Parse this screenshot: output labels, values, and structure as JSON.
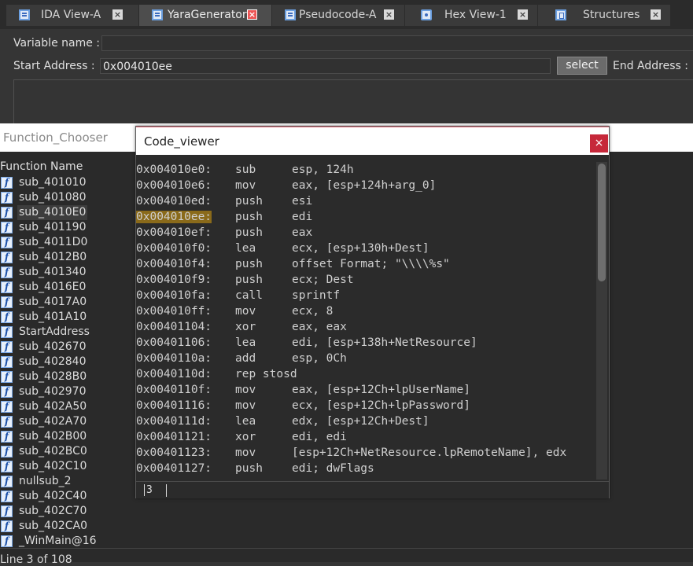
{
  "tabs": [
    {
      "label": "IDA View-A",
      "icon": "ida-view-icon",
      "active": false
    },
    {
      "label": "YaraGenerator",
      "icon": "yara-generator-icon",
      "active": true
    },
    {
      "label": "Pseudocode-A",
      "icon": "pseudocode-icon",
      "active": false
    },
    {
      "label": "Hex View-1",
      "icon": "hex-view-icon",
      "active": false
    },
    {
      "label": "Structures",
      "icon": "structures-icon",
      "active": false
    }
  ],
  "tab_close_glyph": "×",
  "form": {
    "variable_name_label": "Variable name :",
    "variable_name_value": "",
    "start_address_label": "Start Address :",
    "start_address_value": "0x004010ee",
    "select_label": "select",
    "end_address_label": "End Address :"
  },
  "function_chooser": {
    "title": "Function_Chooser",
    "column_header": "Function Name",
    "functions": [
      "sub_401010",
      "sub_401080",
      "sub_4010E0",
      "sub_401190",
      "sub_4011D0",
      "sub_4012B0",
      "sub_401340",
      "sub_4016E0",
      "sub_4017A0",
      "sub_401A10",
      "StartAddress",
      "sub_402670",
      "sub_402840",
      "sub_4028B0",
      "sub_402970",
      "sub_402A50",
      "sub_402A70",
      "sub_402B00",
      "sub_402BC0",
      "sub_402C10",
      "nullsub_2",
      "sub_402C40",
      "sub_402C70",
      "sub_402CA0",
      "_WinMain@16"
    ],
    "selected_index": 2,
    "status": "Line 3 of 108"
  },
  "code_viewer": {
    "title": "Code_viewer",
    "close_glyph": "×",
    "highlighted_line": 4,
    "lines": [
      {
        "addr": "0x004010e0:",
        "mnemonic": "sub",
        "operands": "esp, 124h"
      },
      {
        "addr": "0x004010e6:",
        "mnemonic": "mov",
        "operands": "eax, [esp+124h+arg_0]"
      },
      {
        "addr": "0x004010ed:",
        "mnemonic": "push",
        "operands": "esi"
      },
      {
        "addr": "0x004010ee:",
        "mnemonic": "push",
        "operands": "edi"
      },
      {
        "addr": "0x004010ef:",
        "mnemonic": "push",
        "operands": "eax"
      },
      {
        "addr": "0x004010f0:",
        "mnemonic": "lea",
        "operands": "ecx, [esp+130h+Dest]"
      },
      {
        "addr": "0x004010f4:",
        "mnemonic": "push",
        "operands": "offset Format; \"\\\\\\\\%s\""
      },
      {
        "addr": "0x004010f9:",
        "mnemonic": "push",
        "operands": "ecx; Dest"
      },
      {
        "addr": "0x004010fa:",
        "mnemonic": "call",
        "operands": "sprintf"
      },
      {
        "addr": "0x004010ff:",
        "mnemonic": "mov",
        "operands": "ecx, 8"
      },
      {
        "addr": "0x00401104:",
        "mnemonic": "xor",
        "operands": "eax, eax"
      },
      {
        "addr": "0x00401106:",
        "mnemonic": "lea",
        "operands": "edi, [esp+138h+NetResource]"
      },
      {
        "addr": "0x0040110a:",
        "mnemonic": "add",
        "operands": "esp, 0Ch"
      },
      {
        "addr": "0x0040110d:",
        "mnemonic": "rep stosd",
        "operands": ""
      },
      {
        "addr": "0x0040110f:",
        "mnemonic": "mov",
        "operands": "eax, [esp+12Ch+lpUserName]"
      },
      {
        "addr": "0x00401116:",
        "mnemonic": "mov",
        "operands": "ecx, [esp+12Ch+lpPassword]"
      },
      {
        "addr": "0x0040111d:",
        "mnemonic": "lea",
        "operands": "edx, [esp+12Ch+Dest]"
      },
      {
        "addr": "0x00401121:",
        "mnemonic": "xor",
        "operands": "edi, edi"
      },
      {
        "addr": "0x00401123:",
        "mnemonic": "mov",
        "operands": "[esp+12Ch+NetResource.lpRemoteName], edx"
      },
      {
        "addr": "0x00401127:",
        "mnemonic": "push",
        "operands": "edi; dwFlags"
      }
    ],
    "footer_value": "3"
  }
}
